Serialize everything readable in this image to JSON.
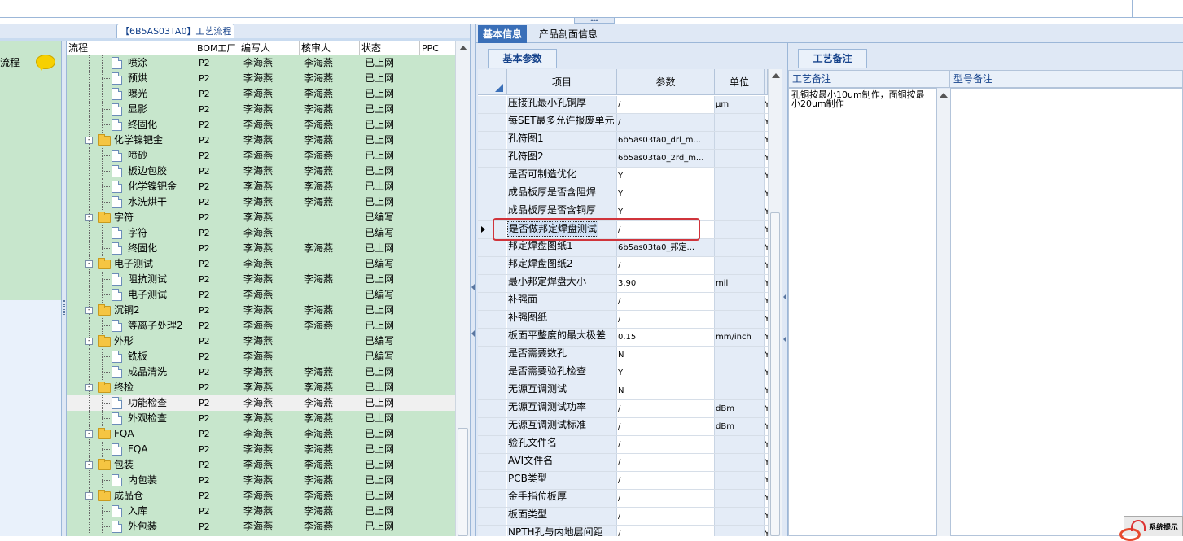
{
  "left_panel": {
    "title": "【6B5AS03TA0】工艺流程",
    "side_label": "流程",
    "columns": [
      "流程",
      "BOM工厂",
      "编写人",
      "核审人",
      "状态",
      "PPC"
    ],
    "rows": [
      {
        "name": "喷涂",
        "level": 2,
        "type": "doc",
        "bom": "P2",
        "writer": "李海燕",
        "reviewer": "李海燕",
        "status": "已上网"
      },
      {
        "name": "预烘",
        "level": 2,
        "type": "doc",
        "bom": "P2",
        "writer": "李海燕",
        "reviewer": "李海燕",
        "status": "已上网"
      },
      {
        "name": "曝光",
        "level": 2,
        "type": "doc",
        "bom": "P2",
        "writer": "李海燕",
        "reviewer": "李海燕",
        "status": "已上网"
      },
      {
        "name": "显影",
        "level": 2,
        "type": "doc",
        "bom": "P2",
        "writer": "李海燕",
        "reviewer": "李海燕",
        "status": "已上网"
      },
      {
        "name": "终固化",
        "level": 2,
        "type": "doc",
        "bom": "P2",
        "writer": "李海燕",
        "reviewer": "李海燕",
        "status": "已上网"
      },
      {
        "name": "化学镍钯金",
        "level": 1,
        "type": "folder",
        "bom": "P2",
        "writer": "李海燕",
        "reviewer": "李海燕",
        "status": "已上网"
      },
      {
        "name": "喷砂",
        "level": 2,
        "type": "doc",
        "bom": "P2",
        "writer": "李海燕",
        "reviewer": "李海燕",
        "status": "已上网"
      },
      {
        "name": "板边包胶",
        "level": 2,
        "type": "doc",
        "bom": "P2",
        "writer": "李海燕",
        "reviewer": "李海燕",
        "status": "已上网"
      },
      {
        "name": "化学镍钯金",
        "level": 2,
        "type": "doc",
        "bom": "P2",
        "writer": "李海燕",
        "reviewer": "李海燕",
        "status": "已上网"
      },
      {
        "name": "水洗烘干",
        "level": 2,
        "type": "doc",
        "bom": "P2",
        "writer": "李海燕",
        "reviewer": "李海燕",
        "status": "已上网"
      },
      {
        "name": "字符",
        "level": 1,
        "type": "folder",
        "bom": "P2",
        "writer": "李海燕",
        "reviewer": "",
        "status": "已编写"
      },
      {
        "name": "字符",
        "level": 2,
        "type": "doc",
        "bom": "P2",
        "writer": "李海燕",
        "reviewer": "",
        "status": "已编写"
      },
      {
        "name": "终固化",
        "level": 2,
        "type": "doc",
        "bom": "P2",
        "writer": "李海燕",
        "reviewer": "李海燕",
        "status": "已上网"
      },
      {
        "name": "电子测试",
        "level": 1,
        "type": "folder",
        "bom": "P2",
        "writer": "李海燕",
        "reviewer": "",
        "status": "已编写"
      },
      {
        "name": "阻抗测试",
        "level": 2,
        "type": "doc",
        "bom": "P2",
        "writer": "李海燕",
        "reviewer": "李海燕",
        "status": "已上网"
      },
      {
        "name": "电子测试",
        "level": 2,
        "type": "doc",
        "bom": "P2",
        "writer": "李海燕",
        "reviewer": "",
        "status": "已编写"
      },
      {
        "name": "沉铜2",
        "level": 1,
        "type": "folder",
        "bom": "P2",
        "writer": "李海燕",
        "reviewer": "李海燕",
        "status": "已上网"
      },
      {
        "name": "等离子处理2",
        "level": 2,
        "type": "doc",
        "bom": "P2",
        "writer": "李海燕",
        "reviewer": "李海燕",
        "status": "已上网"
      },
      {
        "name": "外形",
        "level": 1,
        "type": "folder",
        "bom": "P2",
        "writer": "李海燕",
        "reviewer": "",
        "status": "已编写"
      },
      {
        "name": "铣板",
        "level": 2,
        "type": "doc",
        "bom": "P2",
        "writer": "李海燕",
        "reviewer": "",
        "status": "已编写"
      },
      {
        "name": "成品清洗",
        "level": 2,
        "type": "doc",
        "bom": "P2",
        "writer": "李海燕",
        "reviewer": "李海燕",
        "status": "已上网"
      },
      {
        "name": "终检",
        "level": 1,
        "type": "folder",
        "bom": "P2",
        "writer": "李海燕",
        "reviewer": "李海燕",
        "status": "已上网"
      },
      {
        "name": "功能检查",
        "level": 2,
        "type": "doc",
        "bom": "P2",
        "writer": "李海燕",
        "reviewer": "李海燕",
        "status": "已上网",
        "selected": true
      },
      {
        "name": "外观检查",
        "level": 2,
        "type": "doc",
        "bom": "P2",
        "writer": "李海燕",
        "reviewer": "李海燕",
        "status": "已上网"
      },
      {
        "name": "FQA",
        "level": 1,
        "type": "folder",
        "bom": "P2",
        "writer": "李海燕",
        "reviewer": "李海燕",
        "status": "已上网"
      },
      {
        "name": "FQA",
        "level": 2,
        "type": "doc",
        "bom": "P2",
        "writer": "李海燕",
        "reviewer": "李海燕",
        "status": "已上网"
      },
      {
        "name": "包装",
        "level": 1,
        "type": "folder",
        "bom": "P2",
        "writer": "李海燕",
        "reviewer": "李海燕",
        "status": "已上网"
      },
      {
        "name": "内包装",
        "level": 2,
        "type": "doc",
        "bom": "P2",
        "writer": "李海燕",
        "reviewer": "李海燕",
        "status": "已上网"
      },
      {
        "name": "成品仓",
        "level": 1,
        "type": "folder",
        "bom": "P2",
        "writer": "李海燕",
        "reviewer": "李海燕",
        "status": "已上网"
      },
      {
        "name": "入库",
        "level": 2,
        "type": "doc",
        "bom": "P2",
        "writer": "李海燕",
        "reviewer": "李海燕",
        "status": "已上网"
      },
      {
        "name": "外包装",
        "level": 2,
        "type": "doc",
        "bom": "P2",
        "writer": "李海燕",
        "reviewer": "李海燕",
        "status": "已上网"
      }
    ]
  },
  "main_tabs": [
    "基本信息",
    "产品剖面信息"
  ],
  "basic_params": {
    "tab_label": "基本参数",
    "columns": [
      "项目",
      "参数",
      "单位"
    ],
    "rows": [
      {
        "item": "压接孔最小孔铜厚",
        "param": "/",
        "unit": "μm",
        "tail": "Y",
        "editable": true
      },
      {
        "item": "每SET最多允许报废单元",
        "param": "/",
        "unit": "",
        "tail": "Y",
        "editable": false
      },
      {
        "item": "孔符图1",
        "param": "6b5as03ta0_drl_m...",
        "unit": "",
        "tail": "Y",
        "editable": false
      },
      {
        "item": "孔符图2",
        "param": "6b5as03ta0_2rd_m...",
        "unit": "",
        "tail": "Y",
        "editable": false
      },
      {
        "item": "是否可制造优化",
        "param": "Y",
        "unit": "",
        "tail": "Y",
        "editable": true
      },
      {
        "item": "成品板厚是否含阻焊",
        "param": "Y",
        "unit": "",
        "tail": "Y",
        "editable": true
      },
      {
        "item": "成品板厚是否含铜厚",
        "param": "Y",
        "unit": "",
        "tail": "Y",
        "editable": true
      },
      {
        "item": "是否做邦定焊盘测试",
        "param": "/",
        "unit": "",
        "tail": "Y",
        "editable": true,
        "current": true
      },
      {
        "item": "邦定焊盘图纸1",
        "param": "6b5as03ta0_邦定...",
        "unit": "",
        "tail": "Y",
        "editable": false
      },
      {
        "item": "邦定焊盘图纸2",
        "param": "/",
        "unit": "",
        "tail": "Y",
        "editable": true
      },
      {
        "item": "最小邦定焊盘大小",
        "param": "3.90",
        "unit": "mil",
        "tail": "Y",
        "editable": true
      },
      {
        "item": "补强面",
        "param": "/",
        "unit": "",
        "tail": "Y",
        "editable": true
      },
      {
        "item": "补强图纸",
        "param": "/",
        "unit": "",
        "tail": "Y",
        "editable": true
      },
      {
        "item": "板面平整度的最大极差",
        "param": "0.15",
        "unit": "mm/inch",
        "tail": "Y",
        "editable": true
      },
      {
        "item": "是否需要数孔",
        "param": "N",
        "unit": "",
        "tail": "Y",
        "editable": true
      },
      {
        "item": "是否需要验孔检查",
        "param": "Y",
        "unit": "",
        "tail": "Y",
        "editable": true
      },
      {
        "item": "无源互调测试",
        "param": "N",
        "unit": "",
        "tail": "Y",
        "editable": true
      },
      {
        "item": "无源互调测试功率",
        "param": "/",
        "unit": "dBm",
        "tail": "Y",
        "editable": true
      },
      {
        "item": "无源互调测试标准",
        "param": "/",
        "unit": "dBm",
        "tail": "Y",
        "editable": true
      },
      {
        "item": "验孔文件名",
        "param": "/",
        "unit": "",
        "tail": "Y",
        "editable": true
      },
      {
        "item": "AVI文件名",
        "param": "/",
        "unit": "",
        "tail": "Y",
        "editable": true
      },
      {
        "item": "PCB类型",
        "param": "/",
        "unit": "",
        "tail": "Y",
        "editable": true
      },
      {
        "item": "金手指位板厚",
        "param": "/",
        "unit": "",
        "tail": "Y",
        "editable": true
      },
      {
        "item": "板面类型",
        "param": "/",
        "unit": "",
        "tail": "Y",
        "editable": true
      },
      {
        "item": "NPTH孔与内地层间距",
        "param": "/",
        "unit": "",
        "tail": "Y",
        "editable": true
      }
    ]
  },
  "process_notes": {
    "tab_label": "工艺备注",
    "col1_label": "工艺备注",
    "col2_label": "型号备注",
    "note_text": "孔铜按最小10um制作，面铜按最\n小20um制作"
  },
  "tray": {
    "label": "系统提示"
  },
  "colors": {
    "row_green": "#c7e6cc",
    "tab_active": "#3a6fb8",
    "highlight_box": "#d0343b",
    "grid_header": "#e4ecf7"
  }
}
